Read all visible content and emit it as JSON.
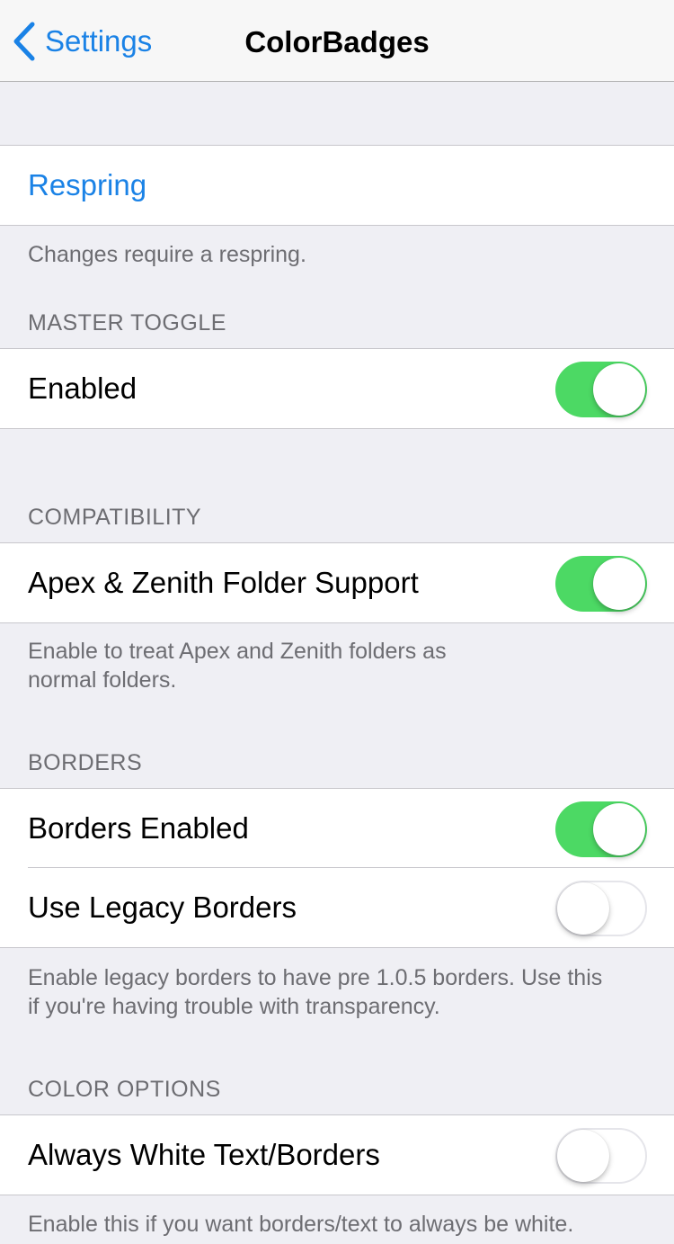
{
  "navbar": {
    "back_label": "Settings",
    "title": "ColorBadges",
    "back_icon": "chevron-left-icon"
  },
  "colors": {
    "accent": "#1a82e6",
    "switch_on": "#4cd964",
    "background": "#efeff4"
  },
  "respring": {
    "label": "Respring",
    "footer": "Changes require a respring."
  },
  "master": {
    "header": "MASTER TOGGLE",
    "enabled_label": "Enabled",
    "enabled_on": true
  },
  "compatibility": {
    "header": "COMPATIBILITY",
    "folder_label": "Apex & Zenith Folder Support",
    "folder_on": true,
    "footer_line1": "Enable to treat Apex and Zenith folders as",
    "footer_line2": "normal folders."
  },
  "borders": {
    "header": "BORDERS",
    "enabled_label": "Borders Enabled",
    "enabled_on": true,
    "legacy_label": "Use Legacy Borders",
    "legacy_on": false,
    "footer_line1": "Enable legacy borders to have pre 1.0.5 borders. Use this",
    "footer_line2": "if you're having trouble with transparency."
  },
  "color_options": {
    "header": "COLOR OPTIONS",
    "white_label": "Always White Text/Borders",
    "white_on": false,
    "footer": "Enable this if you want borders/text to always be white."
  }
}
